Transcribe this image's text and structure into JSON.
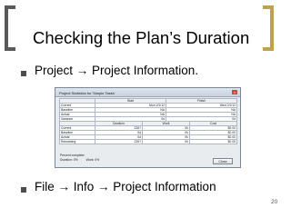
{
  "slide": {
    "title": "Checking the Plan’s Duration",
    "bullets": [
      "Project → Project Information.",
      "File → Info → Project Information"
    ],
    "page_number": "20"
  },
  "dialog": {
    "title": "Project Statistics for 'Simple Tasks'",
    "close_glyph": "×",
    "dates_table": {
      "headers": [
        "",
        "Start",
        "Finish"
      ],
      "rows": [
        [
          "Current",
          "Mon 2/1/12",
          "Wed 2/1/12"
        ],
        [
          "Baseline",
          "NA",
          "NA"
        ],
        [
          "Actual",
          "NA",
          "NA"
        ],
        [
          "Variance",
          "0d",
          "0d"
        ]
      ]
    },
    "stats_table": {
      "headers": [
        "",
        "Duration",
        "Work",
        "Cost"
      ],
      "rows": [
        [
          "Current",
          "226?",
          "0h",
          "$0.00"
        ],
        [
          "Baseline",
          "0d",
          "0h",
          "$0.00"
        ],
        [
          "Actual",
          "0d",
          "0h",
          "$0.00"
        ],
        [
          "Remaining",
          "226?",
          "0h",
          "$0.00"
        ]
      ]
    },
    "percent_complete_label": "Percent complete:",
    "duration_pct": "Duration:  0%",
    "work_pct": "Work:  0%",
    "close_label": "Close"
  },
  "colors": {
    "left_bracket": "#595959",
    "right_bracket": "#bfa24a",
    "bullet": "#4d4d4d"
  }
}
